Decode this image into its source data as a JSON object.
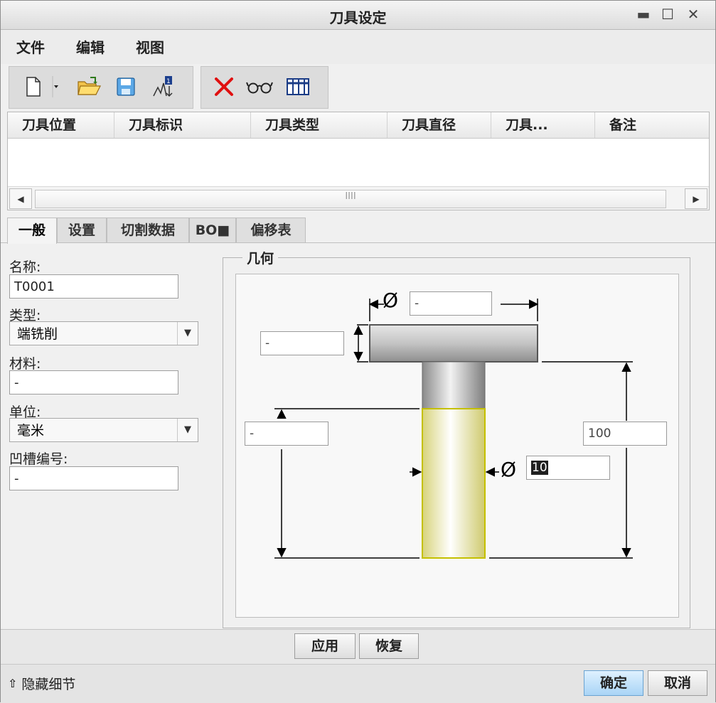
{
  "window": {
    "title": "刀具设定"
  },
  "menu": {
    "items": [
      "文件",
      "编辑",
      "视图"
    ]
  },
  "table": {
    "columns": [
      "刀具位置",
      "刀具标识",
      "刀具类型",
      "刀具直径",
      "刀具...",
      "备注"
    ],
    "scroll_grip": "IIII"
  },
  "tabs": [
    "一般",
    "设置",
    "切割数据",
    "BO■",
    "偏移表"
  ],
  "form": {
    "name_label": "名称:",
    "name_value": "T0001",
    "type_label": "类型:",
    "type_value": "端铣削",
    "material_label": "材料:",
    "material_value": "-",
    "unit_label": "单位:",
    "unit_value": "毫米",
    "groove_label": "凹槽编号:",
    "groove_value": "-"
  },
  "geometry": {
    "group_label": "几何",
    "diameter_symbol": "Ø",
    "head_diameter": "-",
    "head_height": "-",
    "shank_length": "-",
    "total_length": "100",
    "cutter_diameter": "10"
  },
  "actions": {
    "apply": "应用",
    "restore": "恢复",
    "hide_details": "隐藏细节",
    "ok": "确定",
    "cancel": "取消"
  }
}
